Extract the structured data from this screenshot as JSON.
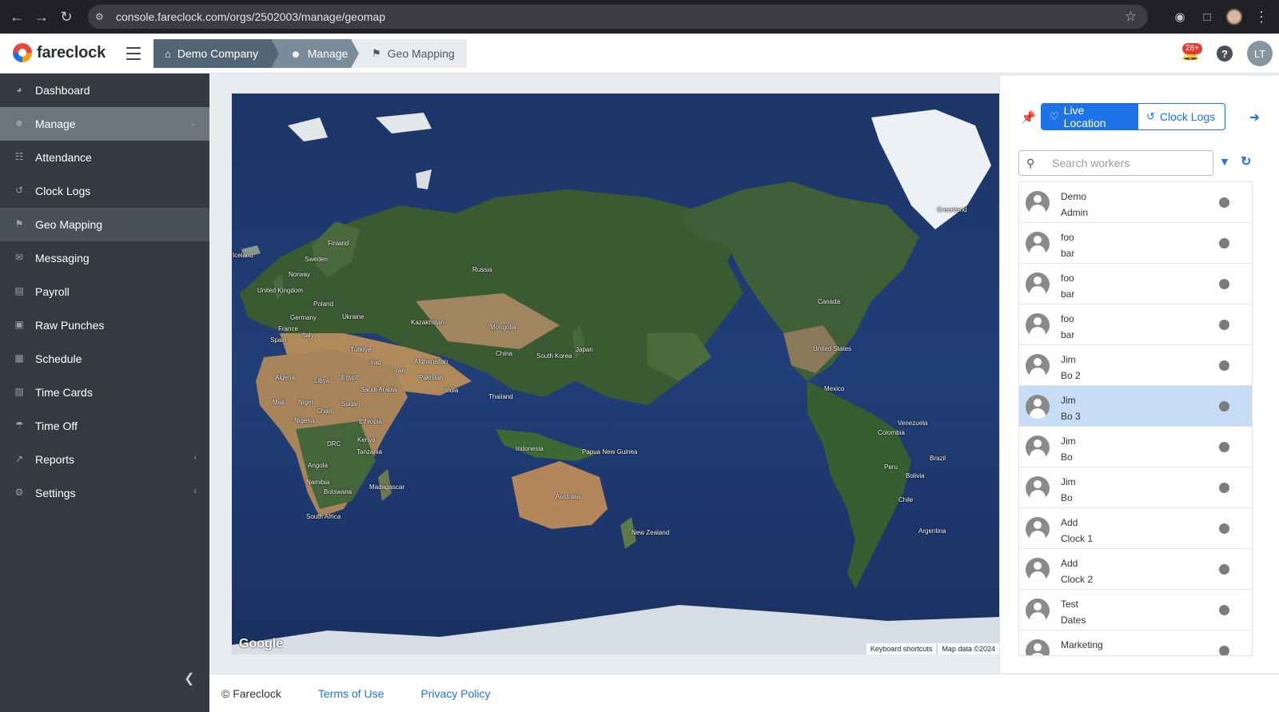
{
  "browser": {
    "url": "console.fareclock.com/orgs/2502003/manage/geomap"
  },
  "header": {
    "logo_text": "fareclock",
    "breadcrumbs": [
      "Demo Company",
      "Manage",
      "Geo Mapping"
    ],
    "notification_count": "28+",
    "help_label": "?",
    "avatar_initials": "LT"
  },
  "sidebar": {
    "items": [
      {
        "label": "Dashboard",
        "icon": "dashboard-icon"
      },
      {
        "label": "Manage",
        "icon": "user-icon"
      },
      {
        "label": "Attendance",
        "icon": "attendance-icon"
      },
      {
        "label": "Clock Logs",
        "icon": "history-icon"
      },
      {
        "label": "Geo Mapping",
        "icon": "map-icon"
      },
      {
        "label": "Messaging",
        "icon": "chat-icon"
      },
      {
        "label": "Payroll",
        "icon": "money-icon"
      },
      {
        "label": "Raw Punches",
        "icon": "car-icon"
      },
      {
        "label": "Schedule",
        "icon": "calendar-icon"
      },
      {
        "label": "Time Cards",
        "icon": "table-icon"
      },
      {
        "label": "Time Off",
        "icon": "umbrella-icon"
      },
      {
        "label": "Reports",
        "icon": "chart-icon"
      },
      {
        "label": "Settings",
        "icon": "gear-icon"
      }
    ]
  },
  "map": {
    "attribution_logo": "Google",
    "keyboard_shortcuts": "Keyboard shortcuts",
    "map_data": "Map data ©2024",
    "labels": [
      "Greenland",
      "Iceland",
      "Finland",
      "Sweden",
      "Norway",
      "Russia",
      "United Kingdom",
      "Poland",
      "Germany",
      "Ukraine",
      "France",
      "Spain",
      "Italy",
      "Kazakhstan",
      "Mongolia",
      "Türkiye",
      "Iraq",
      "Iran",
      "Afghanistan",
      "Pakistan",
      "China",
      "South Korea",
      "Japan",
      "Algeria",
      "Libya",
      "Egypt",
      "Saudi Arabia",
      "India",
      "Thailand",
      "Mali",
      "Niger",
      "Chad",
      "Sudan",
      "Ethiopia",
      "Nigeria",
      "Kenya",
      "DRC",
      "Tanzania",
      "Angola",
      "Namibia",
      "Botswana",
      "Madagascar",
      "South Africa",
      "Indonesia",
      "Papua New Guinea",
      "Australia",
      "New Zealand",
      "Canada",
      "United States",
      "Mexico",
      "Venezuela",
      "Colombia",
      "Peru",
      "Brazil",
      "Bolivia",
      "Chile",
      "Argentina"
    ]
  },
  "panel": {
    "live_location_label": "Live Location",
    "clock_logs_label": "Clock Logs",
    "search_placeholder": "Search workers",
    "workers": [
      {
        "first": "Demo",
        "last": "Admin"
      },
      {
        "first": "foo",
        "last": "bar"
      },
      {
        "first": "foo",
        "last": "bar"
      },
      {
        "first": "foo",
        "last": "bar"
      },
      {
        "first": "Jim",
        "last": "Bo 2"
      },
      {
        "first": "Jim",
        "last": "Bo 3"
      },
      {
        "first": "Jim",
        "last": "Bo"
      },
      {
        "first": "Jim",
        "last": "Bo"
      },
      {
        "first": "Add",
        "last": "Clock 1"
      },
      {
        "first": "Add",
        "last": "Clock 2"
      },
      {
        "first": "Test",
        "last": "Dates"
      },
      {
        "first": "Marketing",
        "last": ""
      }
    ]
  },
  "footer": {
    "copyright": "© Fareclock",
    "terms": "Terms of Use",
    "privacy": "Privacy Policy"
  },
  "colors": {
    "accent": "#1e73e8",
    "sidebar_bg": "#343a40",
    "active_item": "#6c757d",
    "selected_row": "#c7dcf5"
  }
}
